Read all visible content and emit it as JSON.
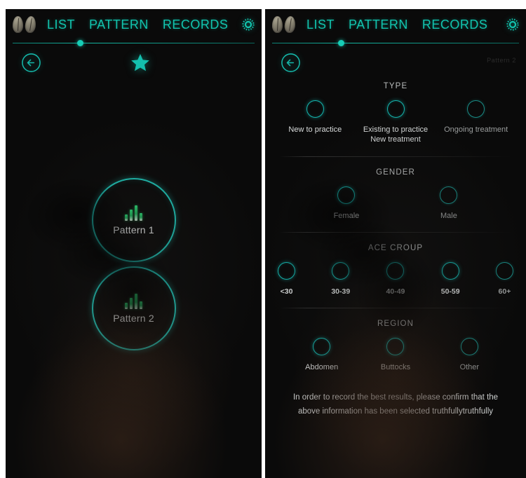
{
  "app": {
    "logo_icon": "two-leaf-logo",
    "accent_color": "#15c2b4",
    "background_color": "#0a0a0a",
    "nav": {
      "tabs": [
        {
          "label": "LIST",
          "name": "tab-list"
        },
        {
          "label": "PATTERN",
          "name": "tab-pattern"
        },
        {
          "label": "RECORDS",
          "name": "tab-records"
        }
      ],
      "settings_icon": "gear-icon",
      "progress_percent": 28
    }
  },
  "left_screen": {
    "back_icon": "back-arrow-icon",
    "favorite_icon": "star-icon",
    "patterns": [
      {
        "label": "Pattern 1",
        "icon": "bar-levels-icon",
        "bars": [
          9,
          16,
          22,
          11
        ]
      },
      {
        "label": "Pattern 2",
        "icon": "bar-levels-icon",
        "bars": [
          9,
          16,
          22,
          11
        ]
      }
    ]
  },
  "right_screen": {
    "back_icon": "back-arrow-icon",
    "corner_label": "Pattern 2",
    "sections": [
      {
        "title": "TYPE",
        "name": "section-type",
        "layout": "thirds",
        "options": [
          {
            "label": "New to practice",
            "selected": false,
            "dim": false
          },
          {
            "label": "Existing to practice\nNew treatment",
            "selected": false,
            "dim": false
          },
          {
            "label": "Ongoing treatment",
            "selected": false,
            "dim": true
          }
        ]
      },
      {
        "title": "GENDER",
        "name": "section-gender",
        "layout": "gender",
        "options": [
          {
            "label": "Female",
            "selected": false,
            "dim": false
          },
          {
            "label": "Male",
            "selected": false,
            "dim": true
          }
        ]
      },
      {
        "title": "ACE CROUP",
        "name": "section-age-group",
        "layout": "age",
        "options": [
          {
            "label": "<30",
            "selected": false,
            "dim": false
          },
          {
            "label": "30-39",
            "selected": false,
            "dim": false
          },
          {
            "label": "40-49",
            "selected": false,
            "dim": false
          },
          {
            "label": "50-59",
            "selected": false,
            "dim": false
          },
          {
            "label": "60+",
            "selected": false,
            "dim": true
          }
        ]
      },
      {
        "title": "REGION",
        "name": "section-region",
        "layout": "region",
        "options": [
          {
            "label": "Abdomen",
            "selected": false,
            "dim": false
          },
          {
            "label": "Buttocks",
            "selected": false,
            "dim": false
          },
          {
            "label": "Other",
            "selected": false,
            "dim": true
          }
        ]
      }
    ],
    "footnote": "In order to record the best results, please confirm that the above information has been selected truthfullytruthfully"
  }
}
